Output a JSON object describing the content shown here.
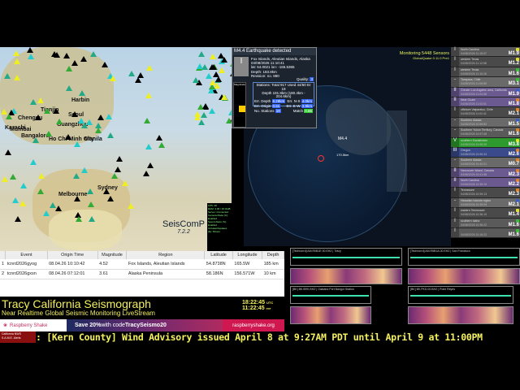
{
  "map": {
    "cities": [
      "Harbin",
      "Tianjin",
      "Seoul",
      "Chengdu",
      "Guangzhou",
      "Karachi",
      "Mumbai",
      "Bangalore",
      "Ho Chi Minh City",
      "Manila",
      "Melbourne",
      "Sydney"
    ],
    "logo": "SeisComP",
    "version": "7.2.2",
    "status": [
      "FPS: 28",
      "RAM: 3.36 / 15.4GiB",
      "Server: Connected",
      "Camera Mode (C): Enabled",
      "Sound Alarm (S): Enabled",
      "Ctrl+Earthquakes (E): Shown"
    ]
  },
  "popup": {
    "title": "M4.4 Earthquake detected",
    "intensity": "I",
    "region": "Fox Islands, Aleutian Islands, Alaska",
    "time": "04/08/2026 11:10:41",
    "latlon": "lat: 54.0021 lon: -165.5365",
    "depth": "Depth: 183.8km",
    "revision": "Revision: no. 880",
    "quality_label": "Quality:",
    "quality": "3",
    "stations": "Stations: Total 917 Used 44/60 Er 19",
    "depth_range": "Depth 191.8km (180.4km - 204.6km)",
    "err": [
      {
        "k": "Err. Depth",
        "v": "6.28km"
      },
      {
        "k": "Err. N-S",
        "v": "4.0km"
      },
      {
        "k": "Err. Origin",
        "v": "0.5s"
      },
      {
        "k": "Err. E-W",
        "v": "3.9km"
      },
      {
        "k": "No. Stations",
        "v": "18"
      },
      {
        "k": "Match",
        "v": "0.85"
      }
    ],
    "magnitude_label": "Magnitude"
  },
  "globe": {
    "monitoring": "Monitoring 5448 Sensors",
    "app": "GlobalQuake 0.11.0 Pre1",
    "event_label": "M4.4",
    "depth_label": "170.5km"
  },
  "quakes": [
    {
      "i": "I",
      "r": "North Carolina",
      "t": "04/08/2026 11:15:07",
      "m": "M1.9",
      "c": "#5a5a5a",
      "d": "#e0e020"
    },
    {
      "i": "I",
      "r": "western Texas",
      "t": "04/08/2026 11:12:58",
      "m": "M1.2",
      "c": "#4a4a4a",
      "d": "#e0e020"
    },
    {
      "i": "I",
      "r": "western Texas",
      "t": "04/08/2026 11:10:16",
      "m": "M1.6",
      "c": "#5a5a5a",
      "d": "#30c030"
    },
    {
      "i": "-",
      "r": "Tarapaca, Chile",
      "t": "04/08/2026 11:06:59",
      "m": "M3.1",
      "c": "#6a6a6a",
      "d": "#30c030"
    },
    {
      "i": "II",
      "r": "Greater Los Angeles area, California",
      "t": "04/08/2026 11:04:08",
      "m": "M1.9",
      "c": "#6a5a90",
      "d": "#3060d0"
    },
    {
      "i": "II",
      "r": "Near Guam",
      "t": "04/08/2026 11:03:01",
      "m": "M1.8",
      "c": "#6a5a90",
      "d": "#e08020"
    },
    {
      "i": "I",
      "r": "offshore Valparaiso, Chile",
      "t": "04/08/2026 11:02:41",
      "m": "M2.1",
      "c": "#4a4a4a",
      "d": "#e08020"
    },
    {
      "i": "-",
      "r": "Southern Alaska",
      "t": "04/08/2026 10:59:52",
      "m": "M1.5",
      "c": "#6a6a6a",
      "d": "#3060d0"
    },
    {
      "i": "-",
      "r": "Southern Yukon Territory, Canada",
      "t": "04/08/2026 10:57:08",
      "m": "M1.6",
      "c": "#5a5a5a",
      "d": "#e08020"
    },
    {
      "i": "V",
      "r": "southern Kazakhstan",
      "t": "04/08/2026 10:55:08",
      "m": "M3.8",
      "c": "#2e9a2e",
      "d": "#e0e020"
    },
    {
      "i": "III",
      "r": "Oregon",
      "t": "04/08/2026 10:50:43",
      "m": "M2.6",
      "c": "#3a4a8a",
      "d": "#e08020"
    },
    {
      "i": "-",
      "r": "Southern Alaska",
      "t": "04/08/2026 10:42:01",
      "m": "M0.7",
      "c": "#6a6a6a",
      "d": "#e08020"
    },
    {
      "i": "II",
      "r": "Vancouver Island, Canada",
      "t": "04/08/2026 10:41:58",
      "m": "M2.3",
      "c": "#6a5a90",
      "d": "#e08020"
    },
    {
      "i": "II",
      "r": "North Carolina",
      "t": "04/08/2026 10:39:19",
      "m": "M2.2",
      "c": "#6a5a90",
      "d": "#e08020"
    },
    {
      "i": "I",
      "r": "Tennessee",
      "t": "04/08/2026 10:39:13",
      "m": "M2.3",
      "c": "#4a4a4a",
      "d": "#e08020"
    },
    {
      "i": "-",
      "r": "Hawaiian Islands region",
      "t": "04/08/2026 10:39:09",
      "m": "M2.1",
      "c": "#6a6a6a",
      "d": "#3060d0"
    },
    {
      "i": "I",
      "r": "eastern Tennessee",
      "t": "04/08/2026 10:36:10",
      "m": "M1.4",
      "c": "#4a4a4a",
      "d": "#e0e020"
    },
    {
      "i": "I",
      "r": "southern Idaho",
      "t": "04/08/2026 10:35:22",
      "m": "M1.6",
      "c": "#5a5a5a",
      "d": "#30c030"
    },
    {
      "i": "I",
      "r": "",
      "t": "04/08/2026 10:18:22",
      "m": "M1.6",
      "c": "#5a5a5a",
      "d": "#30c030"
    }
  ],
  "table": {
    "headers": [
      "",
      "Event",
      "Origin Time",
      "Magnitude",
      "Region",
      "Latitude",
      "Longitude",
      "Depth"
    ],
    "rows": [
      [
        "1",
        "tcnrd2026gyog",
        "08.04.26 10:10:42",
        "4.52",
        "Fox Islands, Aleutian Islands",
        "54.8738N",
        "165.5W",
        "185 km"
      ],
      [
        "2",
        "tcnrd2026gxsn",
        "08.04.26 07:12:01",
        "3.61",
        "Alaska Peninsula",
        "58.186N",
        "156.571W",
        "10 km"
      ]
    ]
  },
  "waves": [
    "[Technorrd] AM.R0B1E.00.EHZ | Tracy",
    "[Technorrd] AM.R5B1A.00.EHZ | San Francisco",
    "[BK] BK.BRK.BHZ | Oakland Port Bangor Station",
    "[BK] BK.PKD.00.BHZ | Point Reyes"
  ],
  "footer": {
    "title": "Tracy California Seismograph",
    "subtitle": "Near Realtime Global Seismic Monitoring LiveStream",
    "utc": "18:22:45",
    "utc_label": "UTC",
    "local": "11:22:45",
    "local_label": "PDT",
    "brand": "Raspberry Shake",
    "promo_pre": "Save 20%",
    "promo_mid": " with code ",
    "promo_code": "TracySeismo20",
    "site": "raspberryshake.org",
    "alert_label_1": "California NWS",
    "alert_label_2": "S.A.M.E. Alerts",
    "ticker": ": [Kern County] Wind Advisory issued April 8 at 9:27AM PDT until April 9 at 11:00PM"
  }
}
